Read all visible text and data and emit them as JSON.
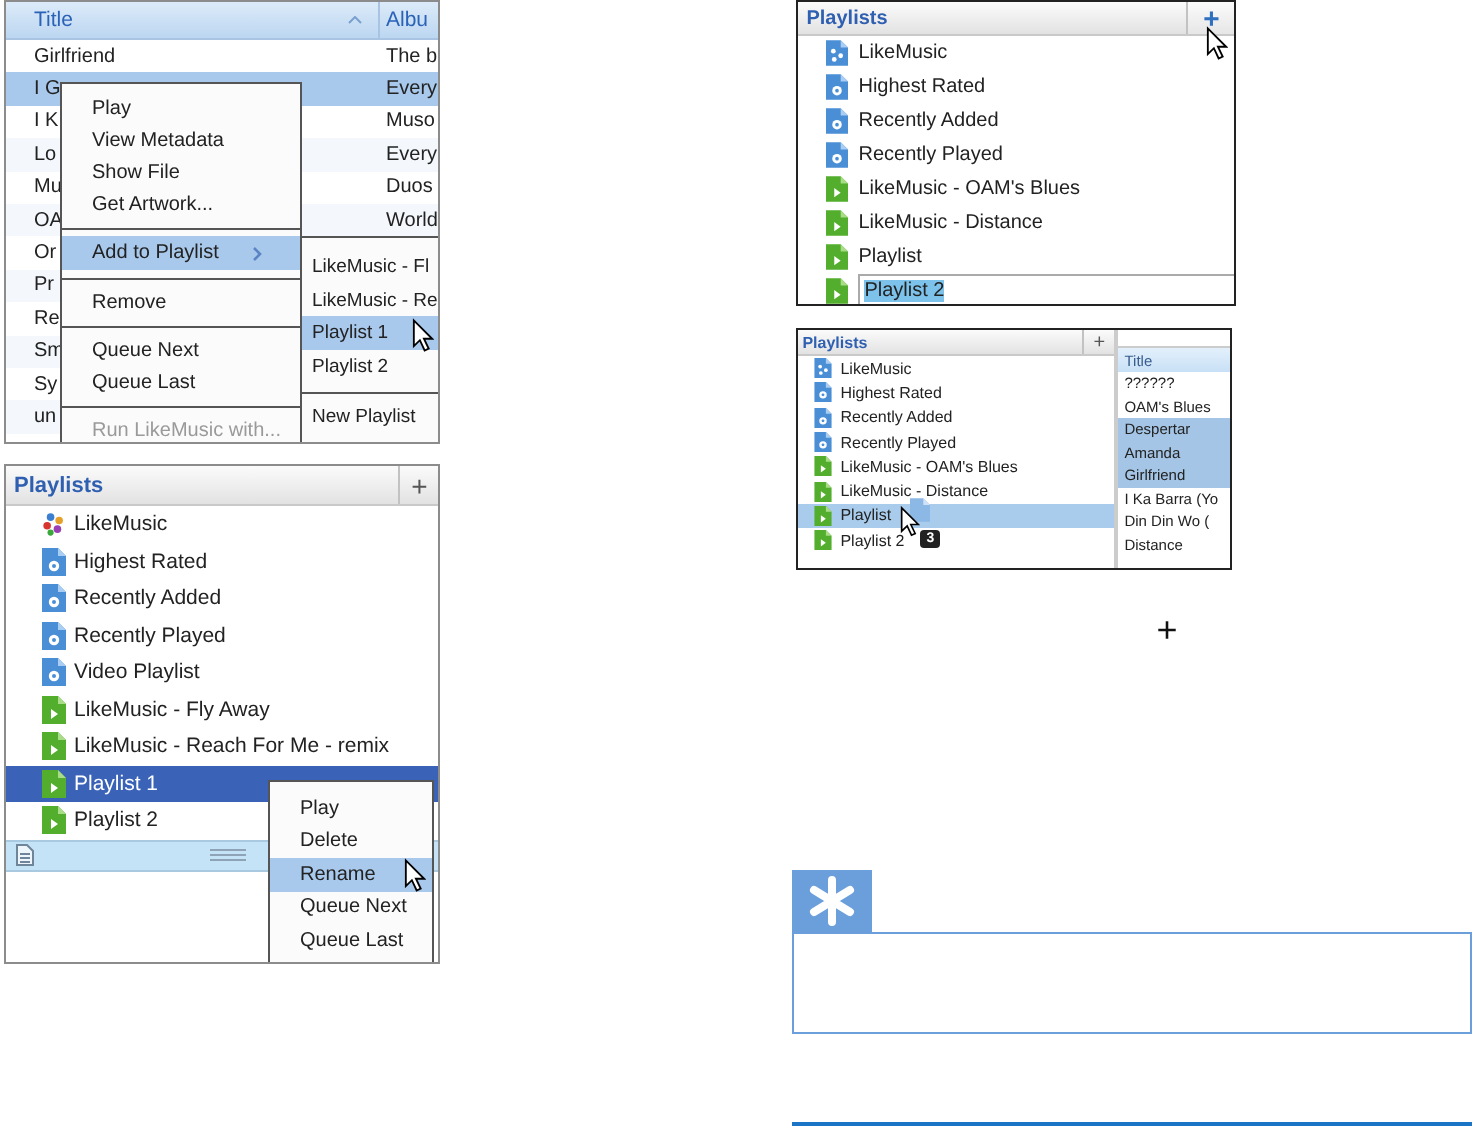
{
  "song_table": {
    "columns": [
      {
        "label": "Title",
        "sorted": true
      },
      {
        "label": "Albu",
        "sorted": false
      }
    ],
    "rows": [
      {
        "title": "Girlfriend",
        "album": "The b",
        "selected": false
      },
      {
        "title": "I G",
        "album": "Every",
        "selected": true
      },
      {
        "title": "I K",
        "album": "Muso",
        "selected": false
      },
      {
        "title": "Lo",
        "album": "Every",
        "selected": false
      },
      {
        "title": "Mu",
        "album": "Duos",
        "selected": false
      },
      {
        "title": "OA",
        "album": "World",
        "selected": false
      },
      {
        "title": "Or",
        "selected": false
      },
      {
        "title": "Pr",
        "selected": false
      },
      {
        "title": "Re",
        "selected": false
      },
      {
        "title": "Sm",
        "selected": false
      },
      {
        "title": "Sy",
        "selected": false
      },
      {
        "title": "un",
        "selected": false
      }
    ]
  },
  "song_menu": {
    "items": [
      {
        "kind": "item",
        "label": "Play",
        "selected": false,
        "disabled": false
      },
      {
        "kind": "item",
        "label": "View Metadata",
        "selected": false,
        "disabled": false
      },
      {
        "kind": "item",
        "label": "Show File",
        "selected": false,
        "disabled": false
      },
      {
        "kind": "item",
        "label": "Get Artwork...",
        "selected": false,
        "disabled": false
      },
      {
        "kind": "separator"
      },
      {
        "kind": "submenu",
        "label": "Add to Playlist",
        "selected": true,
        "disabled": false
      },
      {
        "kind": "separator"
      },
      {
        "kind": "item",
        "label": "Remove",
        "selected": false,
        "disabled": false
      },
      {
        "kind": "separator"
      },
      {
        "kind": "item",
        "label": "Queue Next",
        "selected": false,
        "disabled": false
      },
      {
        "kind": "item",
        "label": "Queue Last",
        "selected": false,
        "disabled": false
      },
      {
        "kind": "separator"
      },
      {
        "kind": "item",
        "label": "Run LikeMusic with...",
        "selected": false,
        "disabled": true
      }
    ]
  },
  "playlist_submenu": {
    "items": [
      {
        "kind": "item",
        "label": "LikeMusic - Fl",
        "selected": false,
        "disabled": false
      },
      {
        "kind": "item",
        "label": "LikeMusic - Re",
        "selected": false,
        "disabled": false
      },
      {
        "kind": "item",
        "label": "Playlist 1",
        "selected": true,
        "disabled": false
      },
      {
        "kind": "item",
        "label": "Playlist 2",
        "selected": false,
        "disabled": false
      },
      {
        "kind": "separator"
      },
      {
        "kind": "item",
        "label": "New Playlist",
        "selected": false,
        "disabled": false
      }
    ]
  },
  "playlists_panel": {
    "title": "Playlists",
    "add_button": "+",
    "items": [
      {
        "kind": "app",
        "label": "LikeMusic",
        "selected": false
      },
      {
        "kind": "smart",
        "label": "Highest Rated",
        "selected": false
      },
      {
        "kind": "smart",
        "label": "Recently Added",
        "selected": false
      },
      {
        "kind": "smart",
        "label": "Recently Played",
        "selected": false
      },
      {
        "kind": "smart",
        "label": "Video Playlist",
        "selected": false
      },
      {
        "kind": "playlist",
        "label": "LikeMusic - Fly Away",
        "selected": false
      },
      {
        "kind": "playlist",
        "label": "LikeMusic - Reach For Me - remix",
        "selected": false
      },
      {
        "kind": "playlist",
        "label": "Playlist 1",
        "selected": true
      },
      {
        "kind": "playlist",
        "label": "Playlist 2",
        "selected": false
      }
    ],
    "context_menu": {
      "items": [
        {
          "kind": "item",
          "label": "Play",
          "selected": false,
          "disabled": false
        },
        {
          "kind": "item",
          "label": "Delete",
          "selected": false,
          "disabled": false
        },
        {
          "kind": "item",
          "label": "Rename",
          "selected": true,
          "disabled": false
        },
        {
          "kind": "item",
          "label": "Queue Next",
          "selected": false,
          "disabled": false
        },
        {
          "kind": "item",
          "label": "Queue Last",
          "selected": false,
          "disabled": false
        }
      ]
    }
  },
  "new_playlist_panel": {
    "title": "Playlists",
    "add_button": "+",
    "items": [
      {
        "kind": "library",
        "label": "LikeMusic",
        "editing": false
      },
      {
        "kind": "smart",
        "label": "Highest Rated",
        "editing": false
      },
      {
        "kind": "smart",
        "label": "Recently Added",
        "editing": false
      },
      {
        "kind": "smart",
        "label": "Recently Played",
        "editing": false
      },
      {
        "kind": "playlist",
        "label": "LikeMusic - OAM's Blues",
        "editing": false
      },
      {
        "kind": "playlist",
        "label": "LikeMusic - Distance",
        "editing": false
      },
      {
        "kind": "playlist",
        "label": "Playlist",
        "editing": false
      },
      {
        "kind": "playlist",
        "label": "Playlist 2",
        "editing": true
      }
    ]
  },
  "drag_panel": {
    "title": "Playlists",
    "add_button": "+",
    "drag_count": "3",
    "items": [
      {
        "kind": "library",
        "label": "LikeMusic",
        "selected": false
      },
      {
        "kind": "smart",
        "label": "Highest Rated",
        "selected": false
      },
      {
        "kind": "smart",
        "label": "Recently Added",
        "selected": false
      },
      {
        "kind": "smart",
        "label": "Recently Played",
        "selected": false
      },
      {
        "kind": "playlist",
        "label": "LikeMusic - OAM's Blues",
        "selected": false
      },
      {
        "kind": "playlist",
        "label": "LikeMusic - Distance",
        "selected": false
      },
      {
        "kind": "playlist",
        "label": "Playlist",
        "selected": true
      },
      {
        "kind": "playlist",
        "label": "Playlist 2",
        "selected": false
      }
    ],
    "track_list": {
      "column": "Title",
      "rows": [
        {
          "title": "??????",
          "selected": false
        },
        {
          "title": "OAM's Blues",
          "selected": false
        },
        {
          "title": "Despertar",
          "selected": true
        },
        {
          "title": "Amanda",
          "selected": true
        },
        {
          "title": "Girlfriend",
          "selected": true
        },
        {
          "title": "I Ka Barra (Yo",
          "selected": false
        },
        {
          "title": "Din Din Wo (",
          "selected": false
        },
        {
          "title": "Distance",
          "selected": false
        }
      ]
    }
  },
  "plus_symbol": "+"
}
